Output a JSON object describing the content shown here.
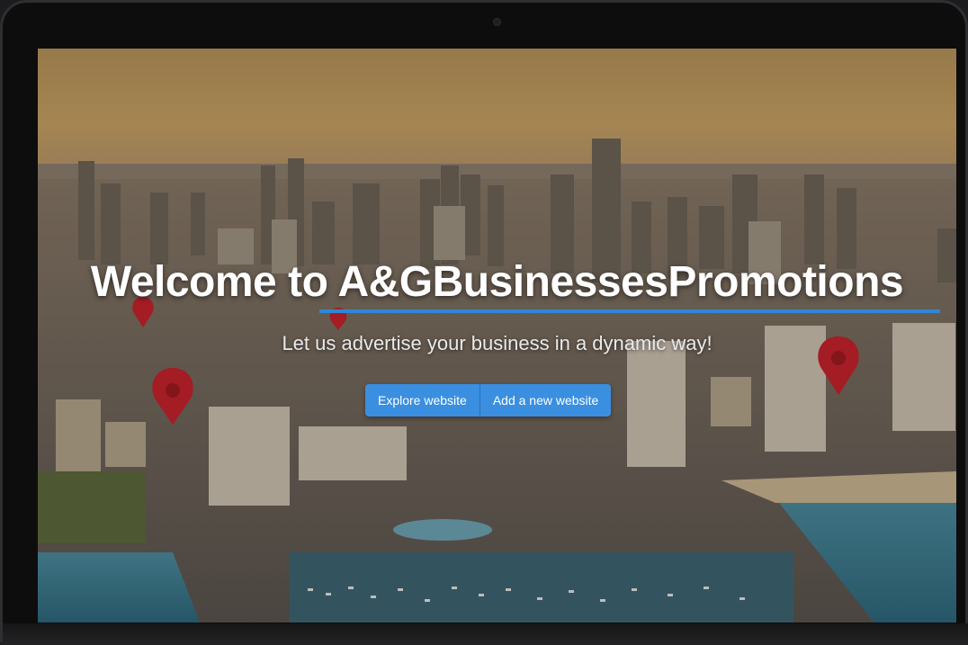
{
  "hero": {
    "title": "Welcome to A&GBusinessesPromotions",
    "subtitle": "Let us advertise your business in a dynamic way!"
  },
  "actions": {
    "explore_label": "Explore website",
    "add_label": "Add a new website"
  },
  "colors": {
    "accent": "#3a8fe0",
    "underline": "#2f86d6",
    "pin": "#c8232c"
  },
  "icons": [
    "map-pin-icon"
  ]
}
